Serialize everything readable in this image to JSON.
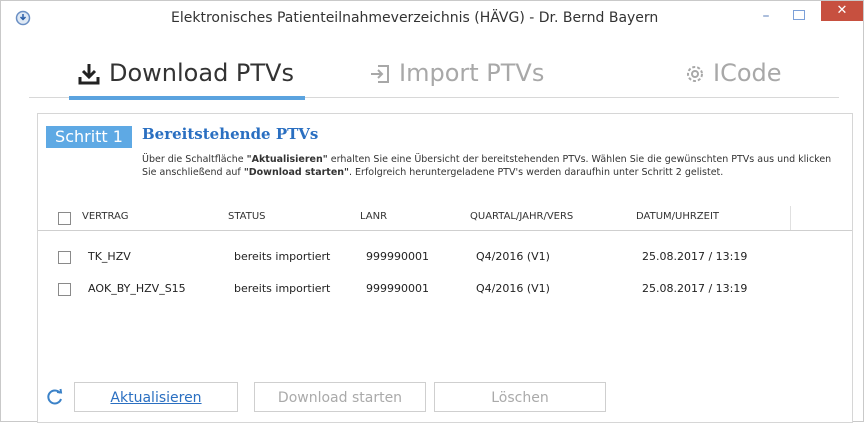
{
  "window": {
    "title": "Elektronisches Patienteilnahmeverzeichnis (HÄVG) - Dr. Bernd Bayern",
    "controls": {
      "minimize": "–",
      "close": "✕"
    }
  },
  "tabs": [
    {
      "label": "Download PTVs",
      "icon": "download-icon",
      "active": true
    },
    {
      "label": "Import PTVs",
      "icon": "import-icon",
      "active": false
    },
    {
      "label": "ICode",
      "icon": "gear-icon",
      "active": false
    }
  ],
  "step": {
    "badge": "Schritt 1",
    "title": "Bereitstehende PTVs",
    "desc_pre": "Über die Schaltfläche ",
    "desc_bold1": "\"Aktualisieren\"",
    "desc_mid": " erhalten Sie eine Übersicht der bereitstehenden PTVs. Wählen Sie die gewünschten PTVs aus und klicken Sie anschließend auf ",
    "desc_bold2": "\"Download starten\"",
    "desc_post": ". Erfolgreich heruntergeladene PTV's werden daraufhin unter Schritt 2 gelistet."
  },
  "table": {
    "headers": [
      "VERTRAG",
      "STATUS",
      "LANR",
      "QUARTAL/JAHR/VERS",
      "DATUM/UHRZEIT"
    ],
    "rows": [
      [
        "TK_HZV",
        "bereits importiert",
        "999990001",
        "Q4/2016 (V1)",
        "25.08.2017 / 13:19"
      ],
      [
        "AOK_BY_HZV_S15",
        "bereits importiert",
        "999990001",
        "Q4/2016 (V1)",
        "25.08.2017 / 13:19"
      ]
    ]
  },
  "buttons": {
    "refresh": "Aktualisieren",
    "download": "Download starten",
    "delete": "Löschen"
  },
  "colors": {
    "accent": "#5ea9e4",
    "link": "#2a6fc1",
    "close": "#c7503f"
  }
}
